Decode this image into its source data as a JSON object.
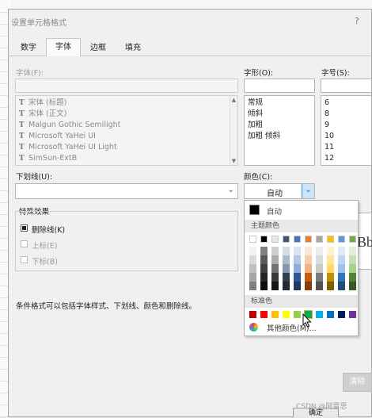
{
  "dialog": {
    "title": "设置单元格格式",
    "help": "?"
  },
  "tabs": [
    {
      "label": "数字",
      "active": false
    },
    {
      "label": "字体",
      "active": true
    },
    {
      "label": "边框",
      "active": false
    },
    {
      "label": "填充",
      "active": false
    }
  ],
  "font": {
    "label": "字体(F):",
    "value": "",
    "items": [
      "宋体 (标题)",
      "宋体 (正文)",
      "Malgun Gothic Semilight",
      "Microsoft YaHei UI",
      "Microsoft YaHei UI Light",
      "SimSun-ExtB"
    ]
  },
  "style": {
    "label": "字形(O):",
    "value": "",
    "items": [
      "常规",
      "倾斜",
      "加粗",
      "加粗 倾斜"
    ]
  },
  "size": {
    "label": "字号(S):",
    "value": "",
    "items": [
      "6",
      "8",
      "9",
      "10",
      "11",
      "12"
    ]
  },
  "underline": {
    "label": "下划线(U):",
    "value": ""
  },
  "color": {
    "label": "颜色(C):",
    "value": "自动"
  },
  "effects": {
    "title": "特殊效果",
    "strikethrough": {
      "label": "删除线(K)",
      "checked": true
    },
    "superscript": {
      "label": "上标(E)",
      "checked": false
    },
    "subscript": {
      "label": "下标(B)",
      "checked": false
    }
  },
  "note": "条件格式可以包括字体样式、下划线、颜色和删除线。",
  "preview_fragment": "Bb",
  "color_popup": {
    "auto_label": "自动",
    "theme_label": "主题颜色",
    "standard_label": "标准色",
    "more_label": "其他颜色(M)...",
    "theme_top": [
      "#ffffff",
      "#000000",
      "#e7e6e6",
      "#44546a",
      "#4472c4",
      "#ed7d31",
      "#a5a5a5",
      "#ffc000",
      "#5b9bd5",
      "#70ad47"
    ],
    "theme_columns": [
      [
        "#f2f2f2",
        "#d9d9d9",
        "#bfbfbf",
        "#a6a6a6",
        "#808080"
      ],
      [
        "#808080",
        "#595959",
        "#404040",
        "#262626",
        "#0d0d0d"
      ],
      [
        "#d0cece",
        "#aeaaaa",
        "#757171",
        "#3a3838",
        "#171616"
      ],
      [
        "#d6dce4",
        "#adb9ca",
        "#8497b0",
        "#333f4f",
        "#222a35"
      ],
      [
        "#dae3f3",
        "#b4c7e7",
        "#8faadc",
        "#2f5597",
        "#1f3864"
      ],
      [
        "#fbe5d6",
        "#f8cbad",
        "#f4b183",
        "#c55a11",
        "#843c0c"
      ],
      [
        "#ededed",
        "#dbdbdb",
        "#c9c9c9",
        "#7b7b7b",
        "#525252"
      ],
      [
        "#fff2cc",
        "#ffe699",
        "#ffd966",
        "#bf9000",
        "#7f6000"
      ],
      [
        "#deebf7",
        "#bdd7ee",
        "#9dc3e6",
        "#2e75b6",
        "#1f4e79"
      ],
      [
        "#e2f0d9",
        "#c5e0b4",
        "#a9d18e",
        "#548235",
        "#385723"
      ]
    ],
    "standard": [
      "#c00000",
      "#ff0000",
      "#ffc000",
      "#ffff00",
      "#92d050",
      "#00b050",
      "#00b0f0",
      "#0070c0",
      "#002060",
      "#7030a0"
    ]
  },
  "footer": {
    "ok": "确定",
    "clear": "清除",
    "watermark": "CSDN @阿晋思"
  }
}
